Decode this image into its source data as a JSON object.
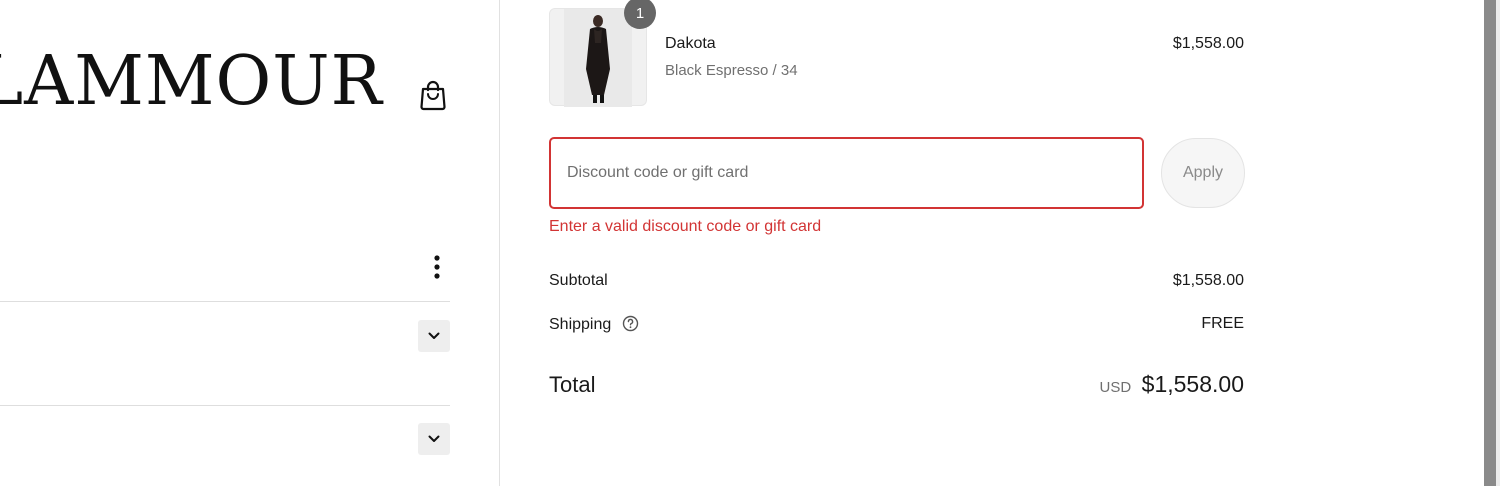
{
  "store": {
    "logo_text": "LAMMOUR"
  },
  "cart_item": {
    "name": "Dakota",
    "variant": "Black Espresso / 34",
    "price": "$1,558.00",
    "quantity": "1"
  },
  "discount": {
    "placeholder": "Discount code or gift card",
    "value": "",
    "apply_label": "Apply",
    "error": "Enter a valid discount code or gift card"
  },
  "summary": {
    "subtotal_label": "Subtotal",
    "subtotal_value": "$1,558.00",
    "shipping_label": "Shipping",
    "shipping_value": "FREE",
    "total_label": "Total",
    "total_currency": "USD",
    "total_value": "$1,558.00"
  },
  "colors": {
    "error": "#d23434",
    "badge": "#666666",
    "muted": "#707070"
  }
}
